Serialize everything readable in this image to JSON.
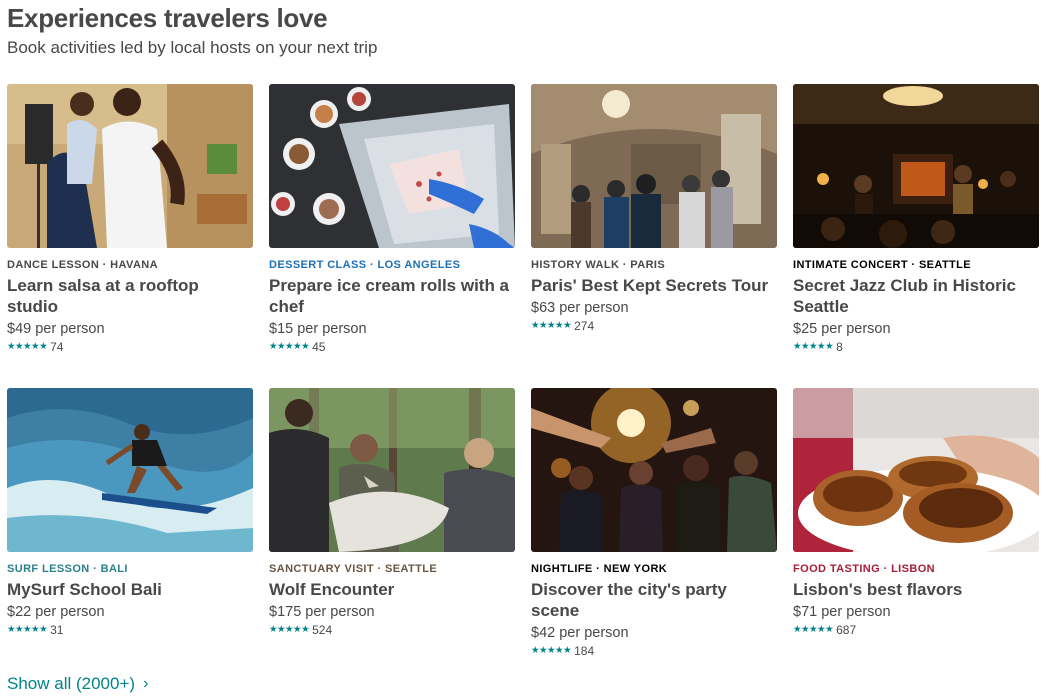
{
  "header": {
    "title": "Experiences travelers love",
    "subtitle": "Book activities led by local hosts on your next trip"
  },
  "experiences": [
    {
      "category": "DANCE LESSON · HAVANA",
      "category_color": "#484848",
      "title": "Learn salsa at a rooftop studio",
      "price": "$49 per person",
      "stars": "★★★★★",
      "reviews": "74"
    },
    {
      "category": "DESSERT CLASS · LOS ANGELES",
      "category_color": "#1d6fb8",
      "title": "Prepare ice cream rolls with a chef",
      "price": "$15 per person",
      "stars": "★★★★★",
      "reviews": "45"
    },
    {
      "category": "HISTORY WALK · PARIS",
      "category_color": "#484848",
      "title": "Paris' Best Kept Secrets Tour",
      "price": "$63 per person",
      "stars": "★★★★★",
      "reviews": "274"
    },
    {
      "category": "INTIMATE CONCERT · SEATTLE",
      "category_color": "#000000",
      "title": "Secret Jazz Club in Historic Seattle",
      "price": "$25 per person",
      "stars": "★★★★★",
      "reviews": "8"
    },
    {
      "category": "SURF LESSON · BALI",
      "category_color": "#2a7f8a",
      "title": "MySurf School Bali",
      "price": "$22 per person",
      "stars": "★★★★★",
      "reviews": "31"
    },
    {
      "category": "SANCTUARY VISIT · SEATTLE",
      "category_color": "#6b5440",
      "title": "Wolf Encounter",
      "price": "$175 per person",
      "stars": "★★★★★",
      "reviews": "524"
    },
    {
      "category": "NIGHTLIFE · NEW YORK",
      "category_color": "#000000",
      "title": "Discover the city's party scene",
      "price": "$42 per person",
      "stars": "★★★★★",
      "reviews": "184"
    },
    {
      "category": "FOOD TASTING · LISBON",
      "category_color": "#a61d3a",
      "title": "Lisbon's best flavors",
      "price": "$71 per person",
      "stars": "★★★★★",
      "reviews": "687"
    }
  ],
  "footer": {
    "show_all": "Show all (2000+)",
    "chevron": "›"
  }
}
